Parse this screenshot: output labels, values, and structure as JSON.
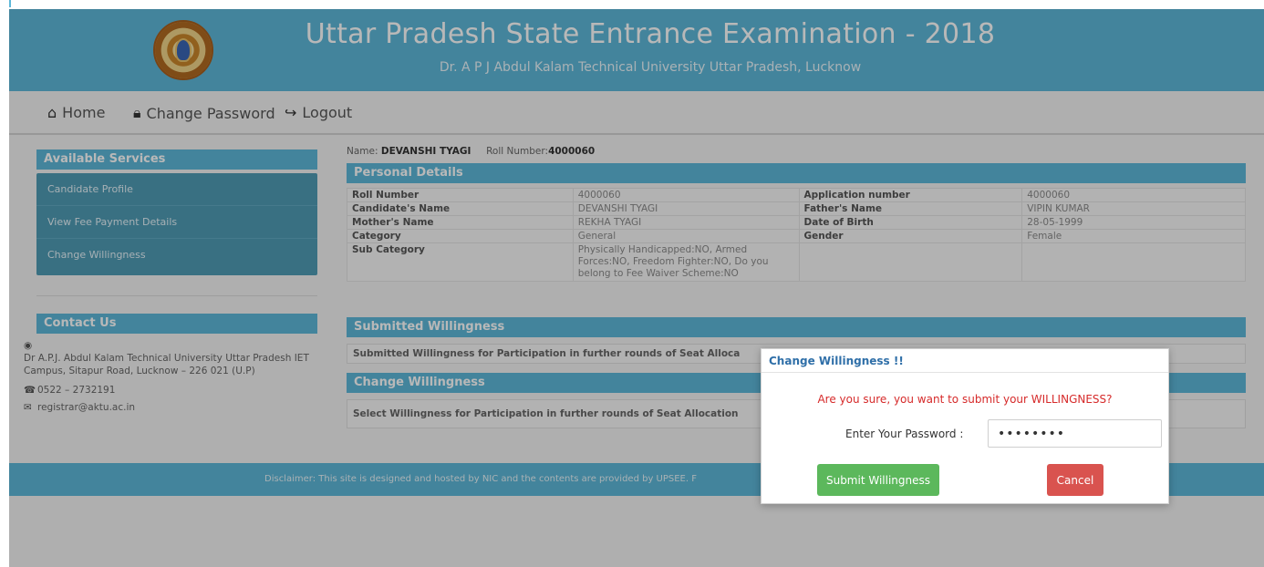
{
  "header": {
    "title": "Uttar Pradesh State Entrance Examination - 2018",
    "subtitle": "Dr. A P J Abdul Kalam Technical University Uttar Pradesh, Lucknow"
  },
  "nav": {
    "items": [
      {
        "label": "Home",
        "icon": "home-icon"
      },
      {
        "label": "Change Password",
        "icon": "lock-icon"
      },
      {
        "label": "Logout",
        "icon": "logout-icon"
      }
    ]
  },
  "sidebar": {
    "services_title": "Available Services",
    "items": [
      {
        "label": "Candidate Profile"
      },
      {
        "label": "View Fee Payment Details"
      },
      {
        "label": "Change Willingness"
      }
    ],
    "contact_title": "Contact Us",
    "address": "Dr A.P.J. Abdul Kalam Technical University Uttar Pradesh IET Campus, Sitapur Road, Lucknow – 226 021 (U.P)",
    "phone": "0522 – 2732191",
    "email": "registrar@aktu.ac.in"
  },
  "candidate": {
    "name_label": "Name:",
    "name": "DEVANSHI TYAGI",
    "roll_label": "Roll Number:",
    "roll": "4000060"
  },
  "personal_details": {
    "title": "Personal Details",
    "rows": [
      [
        "Roll Number",
        "4000060",
        "Application number",
        "4000060"
      ],
      [
        "Candidate's Name",
        "DEVANSHI TYAGI",
        "Father's Name",
        "VIPIN KUMAR"
      ],
      [
        "Mother's Name",
        "REKHA TYAGI",
        "Date of Birth",
        "28-05-1999"
      ],
      [
        "Category",
        "General",
        "Gender",
        "Female"
      ],
      [
        "Sub Category",
        "Physically Handicapped:NO, Armed Forces:NO, Freedom Fighter:NO, Do you belong to Fee Waiver Scheme:NO",
        "",
        ""
      ]
    ]
  },
  "submitted_willingness": {
    "title": "Submitted Willingness",
    "text": "Submitted Willingness for Participation in further rounds of Seat Alloca"
  },
  "change_willingness": {
    "title": "Change Willingness",
    "text": "Select Willingness for Participation in further rounds of Seat Allocation"
  },
  "footer": {
    "text": "Disclaimer: This site is designed and hosted by NIC and the contents are provided by UPSEE. F"
  },
  "modal": {
    "title": "Change Willingness !!",
    "message": "Are you sure, you want to submit your WILLINGNESS?",
    "password_label": "Enter Your Password :",
    "password_value": "••••••••",
    "submit_label": "Submit Willingness",
    "cancel_label": "Cancel"
  },
  "colors": {
    "header_blue": "#5db7d8",
    "menu_blue": "#4f9bb5",
    "submit_green": "#5cb85c",
    "cancel_red": "#d9534f",
    "message_red": "#d62a2a",
    "modal_title_blue": "#2f6fa8"
  }
}
